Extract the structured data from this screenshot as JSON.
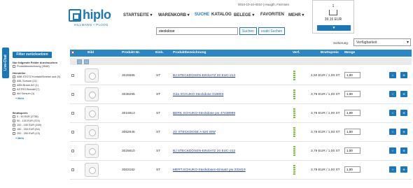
{
  "brand": {
    "logo": "hiplo",
    "sub": "HILLMANN + PLOOG"
  },
  "nav": [
    {
      "label": "STARTSEITE ▾",
      "active": false
    },
    {
      "label": "WARENKORB ▾",
      "active": false
    },
    {
      "label": "SUCHE",
      "active": true
    },
    {
      "label": "KATALOG",
      "active": false
    },
    {
      "label": "BELEGE ▾",
      "active": false
    },
    {
      "label": "FAVORITEN",
      "active": false
    },
    {
      "label": "MEHR ▾",
      "active": false
    }
  ],
  "user": "0010-10-10-0010 | Haugth, Farmsen",
  "search": {
    "value": "steckdose",
    "btn_search": "Suchen",
    "btn_exact": "exakt Suchen"
  },
  "cart": {
    "count": "1",
    "total": "39,15 EUR",
    "btn": "▼"
  },
  "sort": {
    "label": "Sortierung:",
    "value": "Verfügbarkeit"
  },
  "livechat": "Live-Chat",
  "filter": {
    "reset": "Filter zurücksetzen",
    "intro": "Nur folgende Felder durchsuchen",
    "intro_items": [
      "Produktbezeichnung (3548)"
    ],
    "hersteller_title": "Hersteller",
    "hersteller": [
      "ABB STOTZ Kontakt/Striebel und (5)",
      "ABL Sursum (11)",
      "ABN Braun AG (1)",
      "ASTRO Bloedel (7)",
      "Abl Sursum (1)"
    ],
    "more": "+ Mehr",
    "preis_title": "Bruttopreis",
    "preis": [
      "0 - 50 EUR (2736)",
      "50 - 100 EUR (374)",
      "100 - 150 EUR (165)",
      "150 - 200 EUR (54)",
      "200 - 250 EUR (13)"
    ]
  },
  "table": {
    "headers": {
      "bild": "Bild",
      "nr": "Produkt-Nr.",
      "einh": "Einh.",
      "desc": "Produktbezeichnung",
      "verf": "Verf.",
      "preis": "Bruttopreis",
      "menge": "Menge"
    },
    "rows": [
      {
        "nr": "3025585",
        "unit": "ST",
        "desc": "BJ STECKDOSEN-EINSATZ 20 EUC-214",
        "price": "4,50 EUR / 1,00 ST",
        "qty": "1,00"
      },
      {
        "nr": "3038295",
        "unit": "ST",
        "desc": "Gira SCHUKO-Steckdose 018803",
        "price": "3,79 EUR / 1,00 ST",
        "qty": "1,00"
      },
      {
        "nr": "3016913",
        "unit": "ST",
        "desc": "BERK SCHUKO-Steckdose pw 47438989",
        "price": "3,79 EUR / 1,00 ST",
        "qty": "1,00"
      },
      {
        "nr": "3052645",
        "unit": "ST",
        "desc": "JG STECKDOSE A 520 WW",
        "price": "3,79 EUR / 1,00 ST",
        "qty": "1,00"
      },
      {
        "nr": "3025610",
        "unit": "ST",
        "desc": "BJ STECKDOSEN-EINSATZ 20 EUC-212",
        "price": "3,79 EUR / 1,00 ST",
        "qty": "1,00"
      },
      {
        "nr": "3063182",
        "unit": "ST",
        "desc": "MERT.SCHUKO-Steckdosen-Einsatz pw 233419",
        "price": "3,79 EUR / 1,00 ST",
        "qty": "1,00"
      }
    ]
  },
  "accent_color": "#1a78b8"
}
